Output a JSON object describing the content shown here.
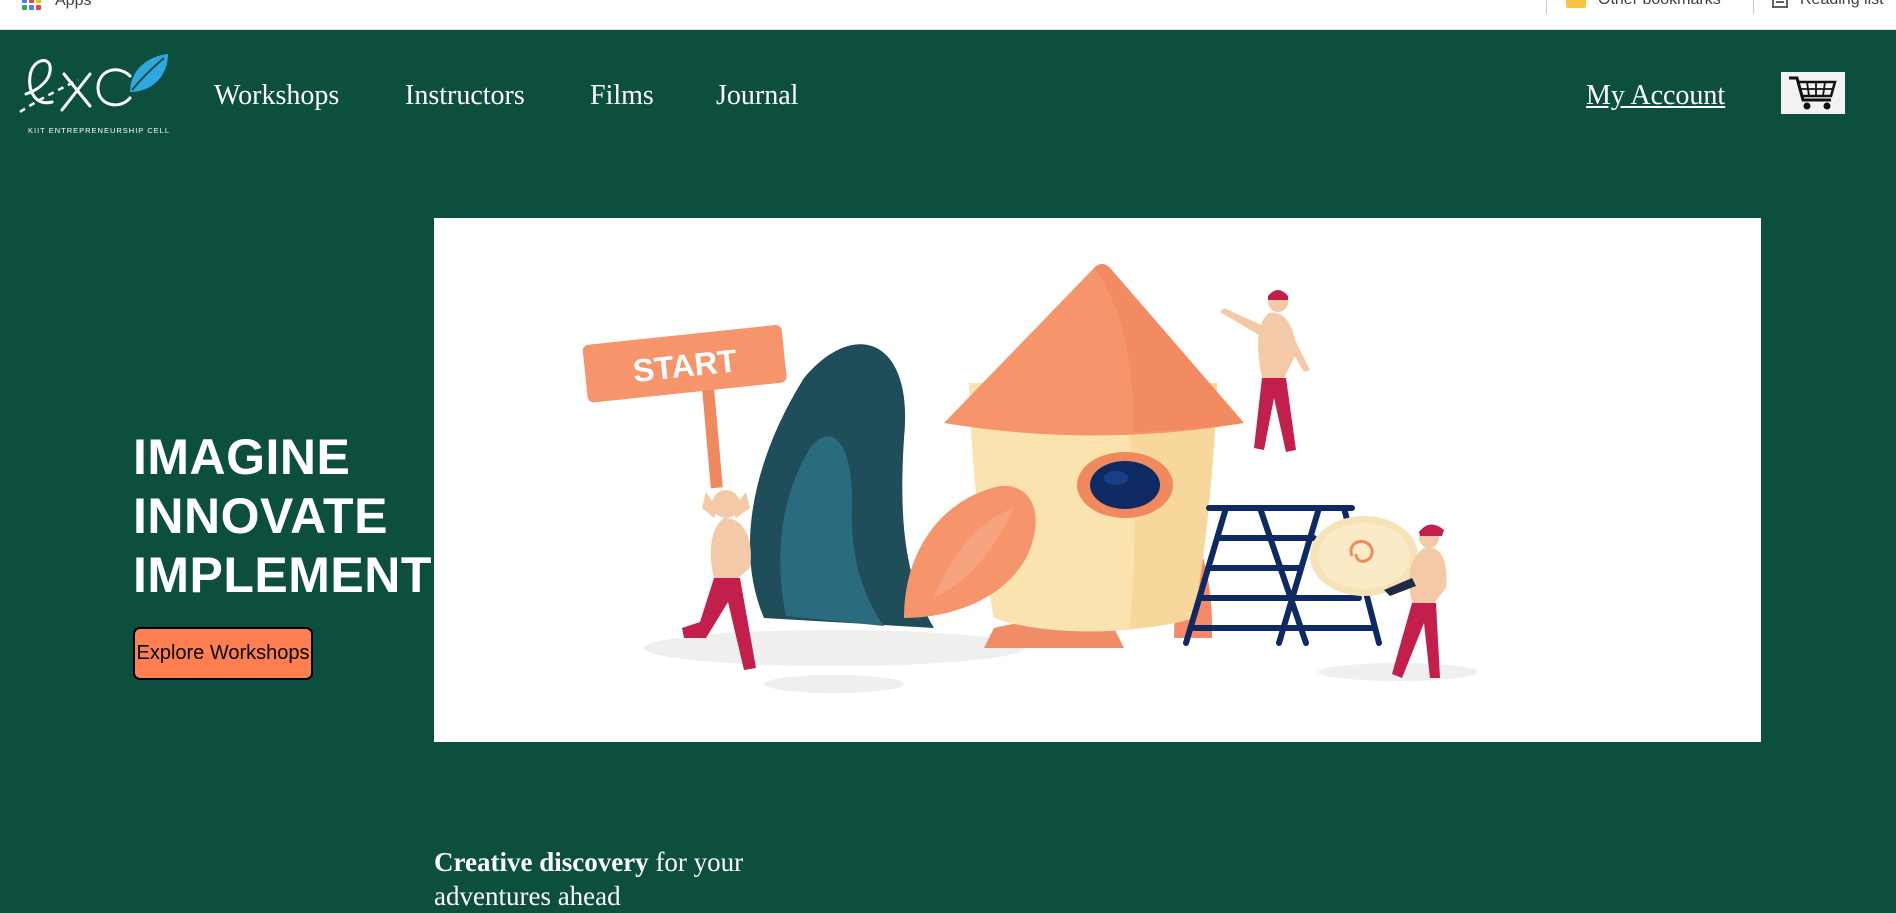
{
  "browser": {
    "bookmarks_bar": {
      "apps_label": "Apps",
      "other_bookmarks_label": "Other bookmarks",
      "reading_list_label": "Reading list"
    }
  },
  "header": {
    "logo_subtitle": "KIIT ENTREPRENEURSHIP CELL",
    "nav": {
      "workshops": "Workshops",
      "instructors": "Instructors",
      "films": "Films",
      "journal": "Journal"
    },
    "account_label": "My Account",
    "cart_icon": "shopping-cart-icon"
  },
  "hero": {
    "lines": [
      "IMAGINE",
      "INNOVATE",
      "IMPLEMENT"
    ],
    "cta_label": "Explore Workshops",
    "illustration_sign_text": "START"
  },
  "tagline": {
    "bold": "Creative discovery",
    "rest": " for your adventures ahead"
  },
  "colors": {
    "background": "#0d4f3f",
    "accent": "#ff7f50",
    "text": "#ffffff"
  }
}
